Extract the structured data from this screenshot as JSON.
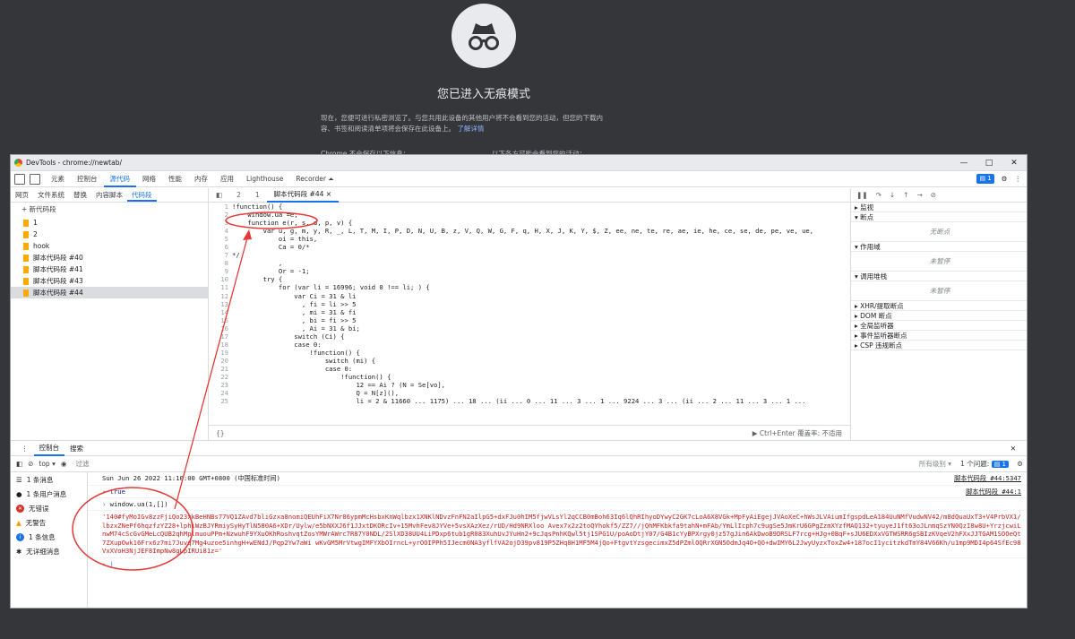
{
  "incognito": {
    "title": "您已进入无痕模式",
    "desc_lines": [
      "现在，您便可进行私密浏览了。与您共用此设备的其他用户将不会看到您的活动，但您的下载内",
      "容、书签和阅读清单项将会保存在此设备上。"
    ],
    "learn_more": "了解详情",
    "left_heading": "Chrome 不会保存以下信息：",
    "right_heading": "以下各方可能会看到您的活动："
  },
  "devtools": {
    "title": "DevTools - chrome://newtab/",
    "window_controls": [
      "—",
      "□",
      "✕"
    ],
    "main_tabs": [
      "元素",
      "控制台",
      "源代码",
      "网络",
      "性能",
      "内存",
      "应用",
      "Lighthouse",
      "Recorder ⏶"
    ],
    "active_main_tab": "源代码",
    "issues_count": "1",
    "nav_tabs": [
      "网页",
      "文件系统",
      "替换",
      "内容脚本",
      "代码段"
    ],
    "new_snippet": "+ 新代码段",
    "snippets": [
      "1",
      "2",
      "hook",
      "脚本代码段 #40",
      "脚本代码段 #41",
      "脚本代码段 #43",
      "脚本代码段 #44"
    ],
    "editor_tabs": [
      "2",
      "1"
    ],
    "editor_active_tab": "脚本代码段 #44 ×",
    "code_lines": [
      {
        "n": "1",
        "t": "!function() {"
      },
      {
        "n": "2",
        "t": "    window.ua =e;"
      },
      {
        "n": "3",
        "t": "    function e(r, s, d, p, v) {"
      },
      {
        "n": "4",
        "t": "        var u, g, m, y, R, _, L, T, M, I, P, D, N, U, B, z, V, Q, W, G, F, q, H, X, J, K, Y, $, Z, ee, ne, te, re, ae, ie, he, ce, se, de, pe, ve, ue,"
      },
      {
        "n": "5",
        "t": "            oi = this,"
      },
      {
        "n": "6",
        "t": "            Ca = 0/*"
      },
      {
        "n": "7",
        "t": "*/"
      },
      {
        "n": "8",
        "t": "            ,"
      },
      {
        "n": "9",
        "t": "            Or = -1;"
      },
      {
        "n": "10",
        "t": "        try {"
      },
      {
        "n": "11",
        "t": "            for (var li = 16996; void 0 !== li; ) {"
      },
      {
        "n": "12",
        "t": "                var Ci = 31 & li"
      },
      {
        "n": "13",
        "t": "                  , fi = li >> 5"
      },
      {
        "n": "14",
        "t": "                  , mi = 31 & fi"
      },
      {
        "n": "15",
        "t": "                  , bi = fi >> 5"
      },
      {
        "n": "16",
        "t": "                  , Ai = 31 & bi;"
      },
      {
        "n": "17",
        "t": "                switch (Ci) {"
      },
      {
        "n": "18",
        "t": "                case 0:"
      },
      {
        "n": "19",
        "t": "                    !function() {"
      },
      {
        "n": "20",
        "t": "                        switch (mi) {"
      },
      {
        "n": "21",
        "t": "                        case 0:"
      },
      {
        "n": "22",
        "t": "                            !function() {"
      },
      {
        "n": "23",
        "t": "                                12 == Ai ? (N = Se[vo],"
      },
      {
        "n": "24",
        "t": "                                Q = N[z](),"
      },
      {
        "n": "25",
        "t": "                                li = 2 & 11660 ... 1175) ... 18 ... (ii ... 0 ... 11 ... 3 ... 1 ... 9224 ... 3 ... (ii ... 2 ... 11 ... 3 ... 1 ..."
      }
    ],
    "status_left": "{}",
    "status_right": "▶ Ctrl+Enter  覆盖率: 不适用",
    "debugger": {
      "sections": [
        {
          "label": "▸ 监视",
          "sub": ""
        },
        {
          "label": "▾ 断点",
          "sub": "无断点"
        },
        {
          "label": "▾ 作用域",
          "sub": "未暂停"
        },
        {
          "label": "▾ 调用堆栈",
          "sub": "未暂停"
        }
      ],
      "collapsed": [
        "▸ XHR/提取断点",
        "▸ DOM 断点",
        "▸ 全局监听器",
        "▸ 事件监听器断点",
        "▸ CSP 违规断点"
      ]
    },
    "drawer_tabs": [
      "控制台",
      "搜索"
    ],
    "console_context": "top ▾",
    "filter_placeholder": "过滤",
    "levels": "所有级别 ▾",
    "issues_text": "1 个问题:",
    "sidebar": [
      "1 条消息",
      "1 条用户消息",
      "无错误",
      "无警告",
      "1 条信息",
      "无详细消息"
    ],
    "console_rows": [
      {
        "text": "Sun Jun 26 2022 11:10:00 GMT+0800 (中国标准时间)",
        "src": "脚本代码段 #44:5347"
      },
      {
        "text": "true",
        "src": "脚本代码段 #44:1"
      },
      {
        "text": "window.ua(1,[])",
        "src": ""
      }
    ],
    "result_string": "'140#fyMoIGv8zzFjiQo23xkBeHNBs77VQ1ZAvd7bliGzxa8nomiQEUhFiX7Nr86ypmMcHsbxKnWqlbzx1XNKlNDvzFnFN2aIlpG5+dxFJu0hIM5fjwVLsYl2qCCB0mBoh63Iq6lQhRIhyoDYwyC2GK7cLoA6X8VGk+MpFyAiEgejJVAoXeC+hWsJLVAiumIfgspdLeA184UuNMfVudwNV42/m8dQuaUxT3+V4PrbVX1/lbzxZNePf6hqzfzYZ28+lphiWzBJYRmiySyHyTlN580A6+XDr/Uylw/e5bNXXJ6f1JJxtDKORcIv+15MvhFev8JYVe+5vsXAzXez/rUD/Hd9NRXloo Avex7x2z2toQYhokf5/ZZ7//jQhMFKbkfa9tahN+mFAb/YmLlIcph7c9ugSe5JmKrU6GPgZzmXYzfMAQ132+tyuyeJ1ft63oJLnmqSzYN0QzI8w8U+YrzjcwiLnwM74cScGvGMeLcQUB2qhMplmuouPPm+NzwuhF9YXuOKhRoshvqtZosYMWrAWrc7R87Y0NDL/2SlXD38UU4LiPDxp6tub1gR083XuhUvJYuHn2+9cJqsPnhKQwl5tj1SPG1U/poAoDtjY07/G4B1cYyBPXrgy0jz57gJin6AkDwoB9DRSLF7rcg+HJg+0BqF+sJU6EDXxVGTWSRR6gSBIzKVqeV2hFXxJJTGAM1SOOeQt7ZXupOwk16Frx6z7mi7Juvq7Mg4uzoe5inhgH+wENdJ/Pqp2Yw7aWi wKvGM5MrVtwgIMFYXbOIrncL+yrOOIPPh5IJecm0NA3yflfVA2ojD39pv819P5ZHq8H1MF5M4jQo+FtgvtYzsgecimxZ5dPZmlOQRrXGN5OdmJq4O+QO+dwIMY6L2JwyUyzxToxZw4+187ocI1ycitzkdTmY84V66Kh/u1mp9MDI4p64SfEc98VxXVoH3NjJEF8ImpNw8gLpIRUi81z='"
  },
  "colors": {
    "accent": "#1a73e8",
    "annotation": "#e53935",
    "string": "#c5221f",
    "keyword": "#881280",
    "number": "#1c00cf"
  }
}
